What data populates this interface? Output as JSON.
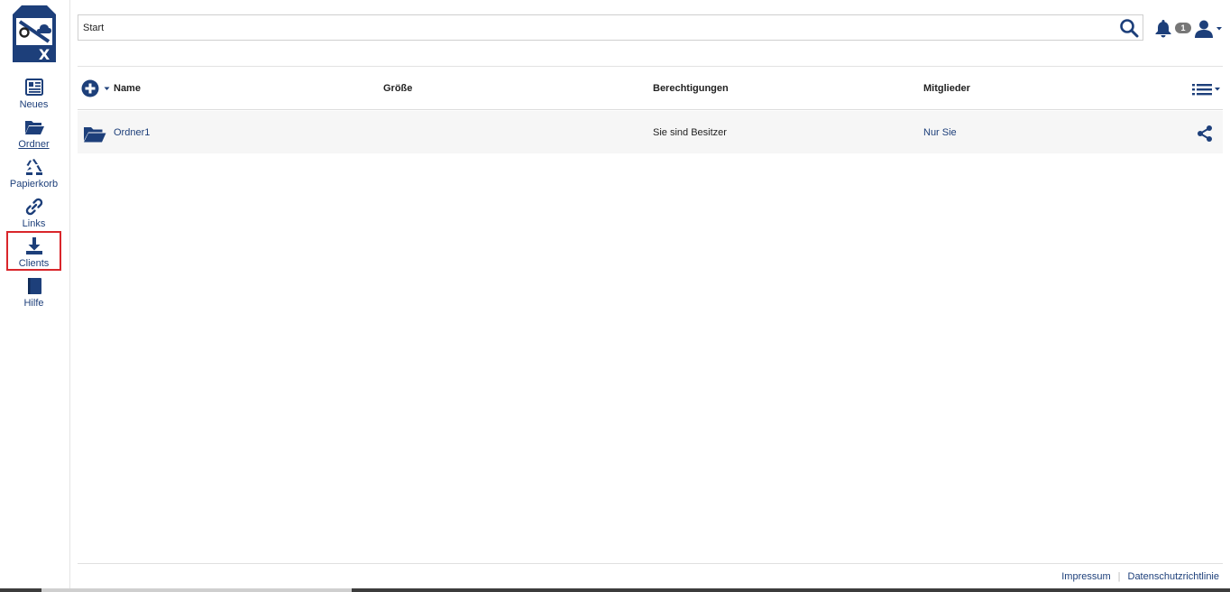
{
  "app": {
    "logo_icon": "ox-drive-logo",
    "brand_color": "#1d3f7a"
  },
  "sidebar": {
    "items": [
      {
        "label": "Neues",
        "icon": "newspaper-icon",
        "active": false
      },
      {
        "label": "Ordner",
        "icon": "folder-open-icon",
        "active": true
      },
      {
        "label": "Papierkorb",
        "icon": "recycle-icon",
        "active": false
      },
      {
        "label": "Links",
        "icon": "link-icon",
        "active": false
      },
      {
        "label": "Clients",
        "icon": "download-icon",
        "active": false,
        "highlighted": true
      },
      {
        "label": "Hilfe",
        "icon": "book-icon",
        "active": false
      }
    ]
  },
  "search": {
    "value": "Start",
    "placeholder": "",
    "icon": "search-icon"
  },
  "topbar": {
    "notifications_count": "1",
    "bell_icon": "bell-icon",
    "user_icon": "user-icon"
  },
  "table": {
    "columns": [
      "Name",
      "Größe",
      "Berechtigungen",
      "Mitglieder"
    ],
    "rows": [
      {
        "name": "Ordner1",
        "size": "",
        "permissions": "Sie sind Besitzer",
        "members": "Nur Sie",
        "icon": "folder-open-icon"
      }
    ]
  },
  "footer": {
    "links": [
      "Impressum",
      "Datenschutzrichtlinie"
    ]
  }
}
